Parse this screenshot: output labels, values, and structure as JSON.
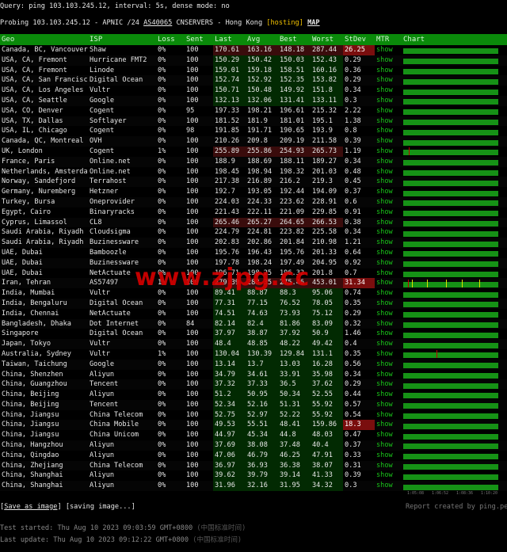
{
  "header": {
    "query_line": "Query: ping 103.103.245.12, interval: 5s, dense mode: no",
    "probe_prefix": "Probing 103.103.245.12 - APNIC /24 ",
    "probe_asn": "AS40065",
    "probe_mid": " CNSERVERS - Hong Kong ",
    "probe_tag": "[hosting]",
    "probe_map": "MAP"
  },
  "columns": [
    "Geo",
    "ISP",
    "Loss",
    "Sent",
    "Last",
    "Avg",
    "Best",
    "Worst",
    "StDev",
    "MTR",
    "Chart"
  ],
  "rows": [
    {
      "geo": "Canada, BC, Vancouver",
      "isp": "Shaw",
      "loss": "0%",
      "sent": "100",
      "last": "170.61",
      "avg": "163.16",
      "best": "148.18",
      "worst": "287.44",
      "stdev": "26.25",
      "heat": "warm",
      "sd": "hot",
      "mtr": "show"
    },
    {
      "geo": "USA, CA, Fremont",
      "isp": "Hurricane FMT2",
      "loss": "0%",
      "sent": "100",
      "last": "150.29",
      "avg": "150.42",
      "best": "150.03",
      "worst": "152.43",
      "stdev": "0.29",
      "heat": "green",
      "sd": "",
      "mtr": "show"
    },
    {
      "geo": "USA, CA, Fremont",
      "isp": "Linode",
      "loss": "0%",
      "sent": "100",
      "last": "159.01",
      "avg": "159.18",
      "best": "158.51",
      "worst": "160.16",
      "stdev": "0.36",
      "heat": "green",
      "sd": "",
      "mtr": "show"
    },
    {
      "geo": "USA, CA, San Francisco",
      "isp": "Digital Ocean",
      "loss": "0%",
      "sent": "100",
      "last": "152.74",
      "avg": "152.92",
      "best": "152.35",
      "worst": "153.82",
      "stdev": "0.29",
      "heat": "green",
      "sd": "",
      "mtr": "show"
    },
    {
      "geo": "USA, CA, Los Angeles",
      "isp": "Vultr",
      "loss": "0%",
      "sent": "100",
      "last": "150.71",
      "avg": "150.48",
      "best": "149.92",
      "worst": "151.8",
      "stdev": "0.34",
      "heat": "green",
      "sd": "",
      "mtr": "show"
    },
    {
      "geo": "USA, CA, Seattle",
      "isp": "Google",
      "loss": "0%",
      "sent": "100",
      "last": "132.13",
      "avg": "132.06",
      "best": "131.41",
      "worst": "133.11",
      "stdev": "0.3",
      "heat": "green",
      "sd": "",
      "mtr": "show"
    },
    {
      "geo": "USA, CO, Denver",
      "isp": "Cogent",
      "loss": "0%",
      "sent": "95",
      "last": "197.33",
      "avg": "198.21",
      "best": "196.61",
      "worst": "215.32",
      "stdev": "2.22",
      "heat": "",
      "sd": "",
      "mtr": "show"
    },
    {
      "geo": "USA, TX, Dallas",
      "isp": "Softlayer",
      "loss": "0%",
      "sent": "100",
      "last": "181.52",
      "avg": "181.9",
      "best": "181.01",
      "worst": "195.1",
      "stdev": "1.38",
      "heat": "",
      "sd": "",
      "mtr": "show"
    },
    {
      "geo": "USA, IL, Chicago",
      "isp": "Cogent",
      "loss": "0%",
      "sent": "98",
      "last": "191.85",
      "avg": "191.71",
      "best": "190.65",
      "worst": "193.9",
      "stdev": "0.8",
      "heat": "",
      "sd": "",
      "mtr": "show"
    },
    {
      "geo": "Canada, QC, Montreal",
      "isp": "OVH",
      "loss": "0%",
      "sent": "100",
      "last": "210.26",
      "avg": "209.8",
      "best": "209.19",
      "worst": "211.58",
      "stdev": "0.39",
      "heat": "",
      "sd": "",
      "mtr": "show"
    },
    {
      "geo": "UK, London",
      "isp": "Cogent",
      "loss": "1%",
      "sent": "100",
      "last": "255.89",
      "avg": "255.86",
      "best": "254.93",
      "worst": "265.73",
      "stdev": "1.19",
      "heat": "warm",
      "sd": "",
      "mtr": "show"
    },
    {
      "geo": "France, Paris",
      "isp": "Online.net",
      "loss": "0%",
      "sent": "100",
      "last": "188.9",
      "avg": "188.69",
      "best": "188.11",
      "worst": "189.27",
      "stdev": "0.34",
      "heat": "",
      "sd": "",
      "mtr": "show"
    },
    {
      "geo": "Netherlands, Amsterdam",
      "isp": "Online.net",
      "loss": "0%",
      "sent": "100",
      "last": "198.45",
      "avg": "198.94",
      "best": "198.32",
      "worst": "201.03",
      "stdev": "0.48",
      "heat": "",
      "sd": "",
      "mtr": "show"
    },
    {
      "geo": "Norway, Sandefjord",
      "isp": "Terrahost",
      "loss": "0%",
      "sent": "100",
      "last": "217.38",
      "avg": "216.89",
      "best": "216.2",
      "worst": "219.3",
      "stdev": "0.45",
      "heat": "",
      "sd": "",
      "mtr": "show"
    },
    {
      "geo": "Germany, Nuremberg",
      "isp": "Hetzner",
      "loss": "0%",
      "sent": "100",
      "last": "192.7",
      "avg": "193.05",
      "best": "192.44",
      "worst": "194.09",
      "stdev": "0.37",
      "heat": "",
      "sd": "",
      "mtr": "show"
    },
    {
      "geo": "Turkey, Bursa",
      "isp": "Oneprovider",
      "loss": "0%",
      "sent": "100",
      "last": "224.03",
      "avg": "224.33",
      "best": "223.62",
      "worst": "228.91",
      "stdev": "0.6",
      "heat": "",
      "sd": "",
      "mtr": "show"
    },
    {
      "geo": "Egypt, Cairo",
      "isp": "Binaryracks",
      "loss": "0%",
      "sent": "100",
      "last": "221.43",
      "avg": "222.11",
      "best": "221.09",
      "worst": "229.85",
      "stdev": "0.91",
      "heat": "",
      "sd": "",
      "mtr": "show"
    },
    {
      "geo": "Cyprus, Limassol",
      "isp": "CL8",
      "loss": "0%",
      "sent": "100",
      "last": "265.46",
      "avg": "265.27",
      "best": "264.65",
      "worst": "266.53",
      "stdev": "0.38",
      "heat": "warm",
      "sd": "",
      "mtr": "show"
    },
    {
      "geo": "Saudi Arabia, Riyadh",
      "isp": "Cloudsigma",
      "loss": "0%",
      "sent": "100",
      "last": "224.79",
      "avg": "224.81",
      "best": "223.82",
      "worst": "225.58",
      "stdev": "0.34",
      "heat": "",
      "sd": "",
      "mtr": "show"
    },
    {
      "geo": "Saudi Arabia, Riyadh",
      "isp": "Buzinessware",
      "loss": "0%",
      "sent": "100",
      "last": "202.83",
      "avg": "202.86",
      "best": "201.84",
      "worst": "210.98",
      "stdev": "1.21",
      "heat": "",
      "sd": "",
      "mtr": "show"
    },
    {
      "geo": "UAE, Dubai",
      "isp": "Bamboozle",
      "loss": "0%",
      "sent": "100",
      "last": "195.76",
      "avg": "196.43",
      "best": "195.76",
      "worst": "201.33",
      "stdev": "0.64",
      "heat": "",
      "sd": "",
      "mtr": "show"
    },
    {
      "geo": "UAE, Dubai",
      "isp": "Buzinessware",
      "loss": "0%",
      "sent": "100",
      "last": "197.78",
      "avg": "198.24",
      "best": "197.49",
      "worst": "204.95",
      "stdev": "0.92",
      "heat": "",
      "sd": "",
      "mtr": "show"
    },
    {
      "geo": "UAE, Dubai",
      "isp": "NetActuate",
      "loss": "0%",
      "sent": "100",
      "last": "196.71",
      "avg": "198.25",
      "best": "196.32",
      "worst": "201.8",
      "stdev": "0.7",
      "heat": "",
      "sd": "",
      "mtr": "show"
    },
    {
      "geo": "Iran, Tehran",
      "isp": "AS57497",
      "loss": "1%",
      "sent": "100",
      "last": "279.39",
      "avg": "283.35",
      "best": "275.46",
      "worst": "453.01",
      "stdev": "31.34",
      "heat": "warm",
      "sd": "hot",
      "mtr": "show"
    },
    {
      "geo": "India, Mumbai",
      "isp": "Vultr",
      "loss": "0%",
      "sent": "100",
      "last": "89.41",
      "avg": "88.87",
      "best": "88.3",
      "worst": "95.06",
      "stdev": "0.74",
      "heat": "green",
      "sd": "",
      "mtr": "show"
    },
    {
      "geo": "India, Bengaluru",
      "isp": "Digital Ocean",
      "loss": "0%",
      "sent": "100",
      "last": "77.31",
      "avg": "77.15",
      "best": "76.52",
      "worst": "78.05",
      "stdev": "0.35",
      "heat": "green",
      "sd": "",
      "mtr": "show"
    },
    {
      "geo": "India, Chennai",
      "isp": "NetActuate",
      "loss": "0%",
      "sent": "100",
      "last": "74.51",
      "avg": "74.63",
      "best": "73.93",
      "worst": "75.12",
      "stdev": "0.29",
      "heat": "green",
      "sd": "",
      "mtr": "show"
    },
    {
      "geo": "Bangladesh, Dhaka",
      "isp": "Dot Internet",
      "loss": "0%",
      "sent": "84",
      "last": "82.14",
      "avg": "82.4",
      "best": "81.86",
      "worst": "83.09",
      "stdev": "0.32",
      "heat": "green",
      "sd": "",
      "mtr": "show"
    },
    {
      "geo": "Singapore",
      "isp": "Digital Ocean",
      "loss": "0%",
      "sent": "100",
      "last": "37.97",
      "avg": "38.87",
      "best": "37.92",
      "worst": "50.9",
      "stdev": "1.46",
      "heat": "green",
      "sd": "",
      "mtr": "show"
    },
    {
      "geo": "Japan, Tokyo",
      "isp": "Vultr",
      "loss": "0%",
      "sent": "100",
      "last": "48.4",
      "avg": "48.85",
      "best": "48.22",
      "worst": "49.42",
      "stdev": "0.4",
      "heat": "green",
      "sd": "",
      "mtr": "show"
    },
    {
      "geo": "Australia, Sydney",
      "isp": "Vultr",
      "loss": "1%",
      "sent": "100",
      "last": "130.04",
      "avg": "130.39",
      "best": "129.84",
      "worst": "131.1",
      "stdev": "0.35",
      "heat": "green",
      "sd": "",
      "mtr": "show"
    },
    {
      "geo": "Taiwan, Taichung",
      "isp": "Google",
      "loss": "0%",
      "sent": "100",
      "last": "13.14",
      "avg": "13.7",
      "best": "13.03",
      "worst": "16.28",
      "stdev": "0.56",
      "heat": "green",
      "sd": "",
      "mtr": "show"
    },
    {
      "geo": "China, Shenzhen",
      "isp": "Aliyun",
      "loss": "0%",
      "sent": "100",
      "last": "34.79",
      "avg": "34.61",
      "best": "33.91",
      "worst": "35.98",
      "stdev": "0.34",
      "heat": "green",
      "sd": "",
      "mtr": "show"
    },
    {
      "geo": "China, Guangzhou",
      "isp": "Tencent",
      "loss": "0%",
      "sent": "100",
      "last": "37.32",
      "avg": "37.33",
      "best": "36.5",
      "worst": "37.62",
      "stdev": "0.29",
      "heat": "green",
      "sd": "",
      "mtr": "show"
    },
    {
      "geo": "China, Beijing",
      "isp": "Aliyun",
      "loss": "0%",
      "sent": "100",
      "last": "51.2",
      "avg": "50.95",
      "best": "50.34",
      "worst": "52.55",
      "stdev": "0.44",
      "heat": "green",
      "sd": "",
      "mtr": "show"
    },
    {
      "geo": "China, Beijing",
      "isp": "Tencent",
      "loss": "0%",
      "sent": "100",
      "last": "52.34",
      "avg": "52.16",
      "best": "51.31",
      "worst": "55.92",
      "stdev": "0.57",
      "heat": "green",
      "sd": "",
      "mtr": "show"
    },
    {
      "geo": "China, Jiangsu",
      "isp": "China Telecom",
      "loss": "0%",
      "sent": "100",
      "last": "52.75",
      "avg": "52.97",
      "best": "52.22",
      "worst": "55.92",
      "stdev": "0.54",
      "heat": "green",
      "sd": "",
      "mtr": "show"
    },
    {
      "geo": "China, Jiangsu",
      "isp": "China Mobile",
      "loss": "0%",
      "sent": "100",
      "last": "49.53",
      "avg": "55.51",
      "best": "48.41",
      "worst": "159.86",
      "stdev": "18.3",
      "heat": "green",
      "sd": "hot",
      "mtr": "show"
    },
    {
      "geo": "China, Jiangsu",
      "isp": "China Unicom",
      "loss": "0%",
      "sent": "100",
      "last": "44.97",
      "avg": "45.34",
      "best": "44.8",
      "worst": "48.03",
      "stdev": "0.47",
      "heat": "green",
      "sd": "",
      "mtr": "show"
    },
    {
      "geo": "China, Hangzhou",
      "isp": "Aliyun",
      "loss": "0%",
      "sent": "100",
      "last": "37.69",
      "avg": "38.08",
      "best": "37.48",
      "worst": "40.4",
      "stdev": "0.37",
      "heat": "green",
      "sd": "",
      "mtr": "show"
    },
    {
      "geo": "China, Qingdao",
      "isp": "Aliyun",
      "loss": "0%",
      "sent": "100",
      "last": "47.06",
      "avg": "46.79",
      "best": "46.25",
      "worst": "47.91",
      "stdev": "0.33",
      "heat": "green",
      "sd": "",
      "mtr": "show"
    },
    {
      "geo": "China, Zhejiang",
      "isp": "China Telecom",
      "loss": "0%",
      "sent": "100",
      "last": "36.97",
      "avg": "36.93",
      "best": "36.38",
      "worst": "38.07",
      "stdev": "0.31",
      "heat": "green",
      "sd": "",
      "mtr": "show"
    },
    {
      "geo": "China, Shanghai",
      "isp": "Aliyun",
      "loss": "0%",
      "sent": "100",
      "last": "39.62",
      "avg": "39.79",
      "best": "39.14",
      "worst": "41.33",
      "stdev": "0.39",
      "heat": "green",
      "sd": "",
      "mtr": "show"
    },
    {
      "geo": "China, Shanghai",
      "isp": "Aliyun",
      "loss": "0%",
      "sent": "100",
      "last": "31.96",
      "avg": "32.16",
      "best": "31.95",
      "worst": "34.32",
      "stdev": "0.3",
      "heat": "green",
      "sd": "",
      "mtr": "show"
    }
  ],
  "spikes": {
    "10": [
      {
        "at": 0.06,
        "color": "#c00000"
      }
    ],
    "23": [
      {
        "at": 0.05,
        "color": "#c00000"
      },
      {
        "at": 0.09,
        "color": "#e0e000"
      },
      {
        "at": 0.25,
        "color": "#e0e000"
      },
      {
        "at": 0.45,
        "color": "#e0e000"
      },
      {
        "at": 0.62,
        "color": "#e0e000"
      },
      {
        "at": 0.8,
        "color": "#e0e000"
      }
    ],
    "30": [
      {
        "at": 0.35,
        "color": "#c00000"
      }
    ]
  },
  "axis_labels": [
    "1:05:08",
    "1:06:52",
    "1:08:36",
    "1:10:20"
  ],
  "footer": {
    "save_label": "Save as image",
    "saving_text": " [saving image...]",
    "report": "Report created by ping.pe",
    "started_label": "Test started: ",
    "started_value": "Thu Aug 10 2023 09:03:59 GMT+0800",
    "started_tz": " (中国标准时间)",
    "update_label": "Last update: ",
    "update_value": "Thu Aug 10 2023 09:12:22 GMT+0800",
    "update_tz": " (中国标准时间)"
  },
  "watermark": "www.zjpg.cc",
  "colors": {
    "header_green": "#0a8a0a",
    "bar_green": "#169216",
    "stdev_hot": "#7a0e0e",
    "tag_yellow": "#f0c000"
  }
}
